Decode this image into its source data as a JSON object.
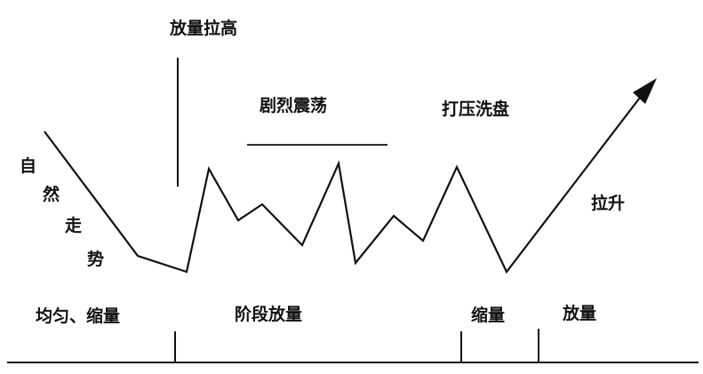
{
  "diagram": {
    "top_labels": {
      "volume_lift": "放量拉高",
      "violent_oscillation": "剧烈震荡",
      "suppress_washout": "打压洗盘",
      "pull_up": "拉升"
    },
    "natural_trend": [
      "自",
      "然",
      "走",
      "势"
    ],
    "bottom_labels": {
      "uniform_shrink": "均匀、缩量",
      "stage_volume": "阶段放量",
      "shrink": "缩量",
      "expand": "放量"
    }
  }
}
